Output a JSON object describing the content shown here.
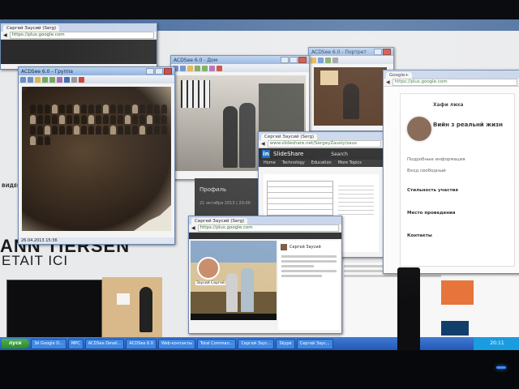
{
  "background_page": {
    "banner_line1": "ANN TIERSEN",
    "banner_line2": "ETAIT ICI",
    "left_label": "ВИДЕО"
  },
  "window_gplus_left": {
    "title": "Сергей Заусий (Serg)",
    "tab": "Сергей Заусий (Serg)",
    "url": "https://plus.google.com"
  },
  "window_acdsee_group": {
    "title": "ACDSee 6.0 - Группа",
    "timestamp": "26.04.2013 15:36"
  },
  "window_acdsee_house": {
    "title": "ACDSee 6.0 - Дом"
  },
  "window_acdsee_portrait": {
    "title": "ACDSee 6.0 - Портрет"
  },
  "window_slideshare": {
    "title": "Сергей Заусий (Serg)",
    "url": "www.slideshare.net/SergeyZausiy/zaus",
    "brand": "SlideShare",
    "search_label": "Search",
    "nav": [
      "Home",
      "Technology",
      "Education",
      "More Topics"
    ],
    "profile_label": "Профиль",
    "date_label": "21 октября 2013 | 20:00"
  },
  "window_gplus_bottom": {
    "title": "Сергей Заусий (Serg)",
    "url": "https://plus.google.com",
    "person_name": "Сергей Заусий",
    "caption": "Заусий Сергей"
  },
  "window_gplus_right": {
    "title": "Google+",
    "url": "https://plus.google.com",
    "profile_name": "Хафи лиха",
    "heading": "Вийн з реальнй жизн",
    "section1": "Подробные информация",
    "section2": "Вход свободный",
    "field1": "Стильность участия",
    "field2": "Место проведения",
    "field3": "Контакты"
  },
  "taskbar": {
    "start_label": "пуск",
    "buttons": [
      "3й Google D...",
      "MPC",
      "ACDSee Devel...",
      "ACDSee 6.0",
      "Web-контакты",
      "Total Comman...",
      "Сергей Заус...",
      "Skype",
      "Сергей Заус..."
    ],
    "clock": "20:11"
  },
  "colors": {
    "title_gradient_top": "#b9d1ef",
    "taskbar_blue": "#2458b4",
    "linkedin_blue": "#0a66c2",
    "start_green": "#3a9a3a"
  }
}
